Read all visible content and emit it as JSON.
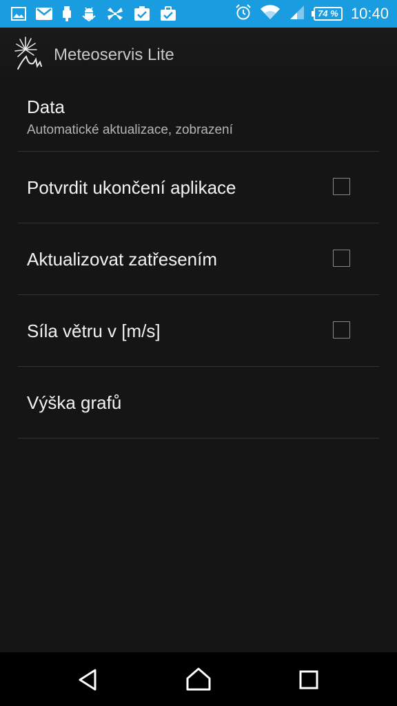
{
  "status_bar": {
    "battery_level": "74 %",
    "time": "10:40",
    "icons": [
      "image-icon",
      "mail-icon",
      "usb-icon",
      "android-debug-icon",
      "pinwheel-icon",
      "clipboard-check-icon",
      "briefcase-check-icon",
      "alarm-icon",
      "wifi-icon",
      "signal-icon",
      "battery-icon"
    ],
    "background_color": "#1a9ce0"
  },
  "app_bar": {
    "title": "Meteoservis Lite",
    "logo_icon": "meteoservis-logo-icon"
  },
  "settings": {
    "data": {
      "title": "Data",
      "summary": "Automatické aktualizace, zobrazení"
    },
    "items": [
      {
        "label": "Potvrdit ukončení aplikace",
        "checked": false,
        "has_checkbox": true
      },
      {
        "label": "Aktualizovat zatřesením",
        "checked": false,
        "has_checkbox": true
      },
      {
        "label": "Síla větru v [m/s]",
        "checked": false,
        "has_checkbox": true
      },
      {
        "label": "Výška grafů",
        "has_checkbox": false
      }
    ]
  },
  "nav_bar": {
    "icons": [
      "back-icon",
      "home-icon",
      "recents-icon"
    ]
  }
}
